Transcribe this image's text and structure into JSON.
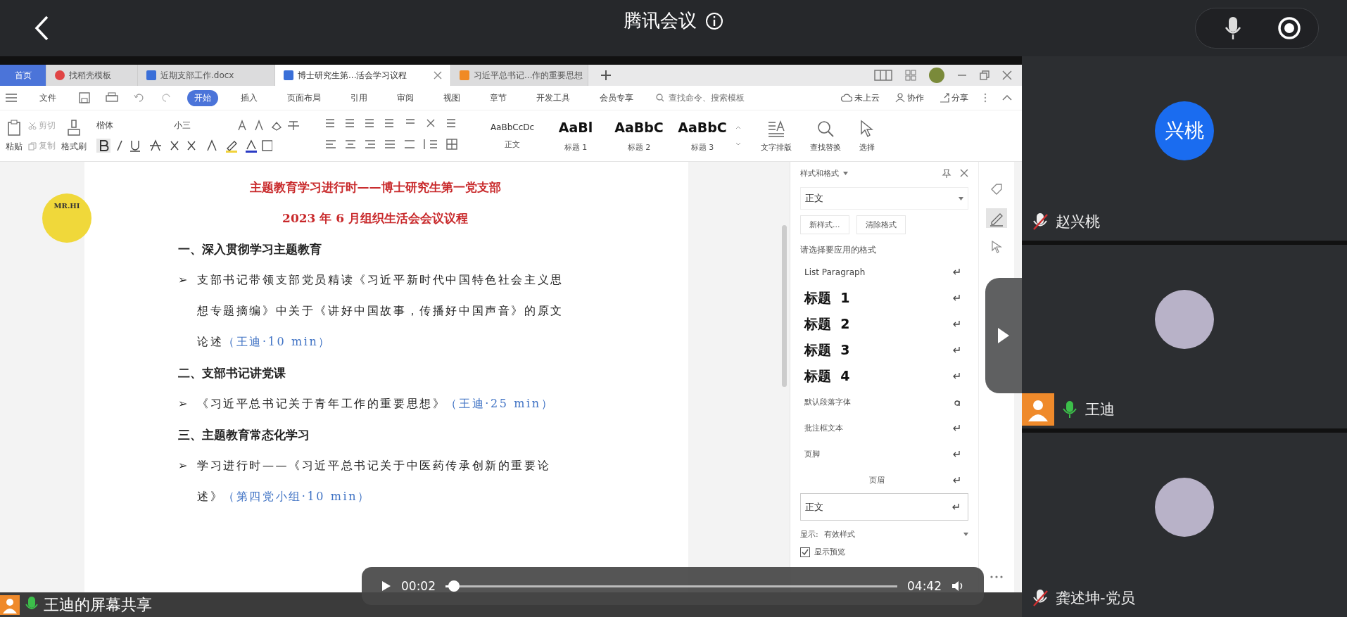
{
  "meeting_bar": {
    "title": "腾讯会议"
  },
  "wps": {
    "tabs": [
      {
        "label": "首页",
        "kind": "home",
        "selected": false
      },
      {
        "label": "找稻壳模板",
        "kind": "template",
        "selected": false
      },
      {
        "label": "近期支部工作.docx",
        "kind": "doc",
        "selected": false
      },
      {
        "label": "博士研究生第...活会学习议程",
        "kind": "doc",
        "selected": true
      },
      {
        "label": "习近平总书记...作的重要思想",
        "kind": "ppt",
        "selected": false
      }
    ],
    "menu": [
      {
        "label": "文件",
        "selected": false
      },
      {
        "label": "开始",
        "selected": true
      },
      {
        "label": "插入",
        "selected": false
      },
      {
        "label": "页面布局",
        "selected": false
      },
      {
        "label": "引用",
        "selected": false
      },
      {
        "label": "审阅",
        "selected": false
      },
      {
        "label": "视图",
        "selected": false
      },
      {
        "label": "章节",
        "selected": false
      },
      {
        "label": "开发工具",
        "selected": false
      },
      {
        "label": "会员专享",
        "selected": false
      }
    ],
    "command_search": {
      "placeholder": "查找命令、搜索模板"
    },
    "actions": [
      {
        "label": "未上云",
        "kind": "cloud"
      },
      {
        "label": "协作",
        "kind": "people"
      },
      {
        "label": "分享",
        "kind": "share"
      }
    ],
    "clipboard": {
      "paste": "粘贴",
      "cut": "剪切",
      "copy": "复制",
      "format_painter": "格式刷"
    },
    "font": {
      "name": "楷体",
      "size": "小三"
    },
    "style_gallery": [
      {
        "sample": "AaBbCcDc",
        "label": "正文",
        "kind": "normal"
      },
      {
        "sample": "AaBl",
        "label": "标题 1",
        "kind": "heading"
      },
      {
        "sample": "AaBbC",
        "label": "标题 2",
        "kind": "heading"
      },
      {
        "sample": "AaBbC",
        "label": "标题 3",
        "kind": "heading"
      }
    ],
    "tools": [
      {
        "label": "文字排版",
        "kind": "layout"
      },
      {
        "label": "查找替换",
        "kind": "find"
      },
      {
        "label": "选择",
        "kind": "select"
      }
    ]
  },
  "document": {
    "logo": "MR.HI",
    "title": "主题教育学习进行时——博士研究生第一党支部",
    "subtitle": "2023 年 6 月组织生活会会议议程",
    "blocks": [
      {
        "kind": "heading",
        "text": "一、深入贯彻学习主题教育"
      },
      {
        "kind": "bullet",
        "marker": "➢",
        "text": "支部书记带领支部党员精读《习近平新时代中国特色社会主义思想专题摘编》中关于《讲好中国故事，传播好中国声音》的原文论述",
        "note": "（王迪·10 min）"
      },
      {
        "kind": "heading",
        "text": "二、支部书记讲党课"
      },
      {
        "kind": "bullet",
        "marker": "➢",
        "text": "《习近平总书记关于青年工作的重要思想》",
        "note": "（王迪·25 min）"
      },
      {
        "kind": "heading",
        "text": "三、主题教育常态化学习"
      },
      {
        "kind": "bullet",
        "marker": "➢",
        "text": "学习进行时——《习近平总书记关于中医药传承创新的重要论述》",
        "note": "（第四党小组·10 min）"
      }
    ]
  },
  "styles_panel": {
    "title": "样式和格式",
    "current": "正文",
    "buttons": [
      "新样式...",
      "清除格式"
    ],
    "prompt": "请选择要应用的格式",
    "items": [
      {
        "label": "List Paragraph",
        "kind": "list",
        "selected": false
      },
      {
        "label": "标题  1",
        "kind": "heading",
        "selected": false
      },
      {
        "label": "标题  2",
        "kind": "heading",
        "selected": false
      },
      {
        "label": "标题  3",
        "kind": "heading",
        "selected": false
      },
      {
        "label": "标题  4",
        "kind": "heading",
        "selected": false
      },
      {
        "label": "默认段落字体",
        "kind": "character",
        "selected": false
      },
      {
        "label": "批注框文本",
        "kind": "small",
        "selected": false
      },
      {
        "label": "页脚",
        "kind": "small",
        "selected": false
      },
      {
        "label": "页眉",
        "kind": "centered",
        "selected": false
      },
      {
        "label": "正文",
        "kind": "small",
        "selected": true
      }
    ],
    "show_label": "显示:",
    "show_value": "有效样式",
    "preview": {
      "label": "显示预览",
      "checked": true
    }
  },
  "status_bar": {
    "share_label": "王迪的屏幕共享"
  },
  "video": {
    "current": "00:02",
    "duration": "04:42",
    "level": 0.01
  },
  "participants": [
    {
      "name": "赵兴桃",
      "muted": true,
      "host": false,
      "avatar": {
        "kind": "text",
        "text": "兴桃"
      }
    },
    {
      "name": "王迪",
      "muted": false,
      "host": true,
      "avatar": {
        "kind": "picture"
      }
    },
    {
      "name": "龚述坤-党员",
      "muted": true,
      "host": false,
      "avatar": {
        "kind": "picture"
      }
    }
  ]
}
